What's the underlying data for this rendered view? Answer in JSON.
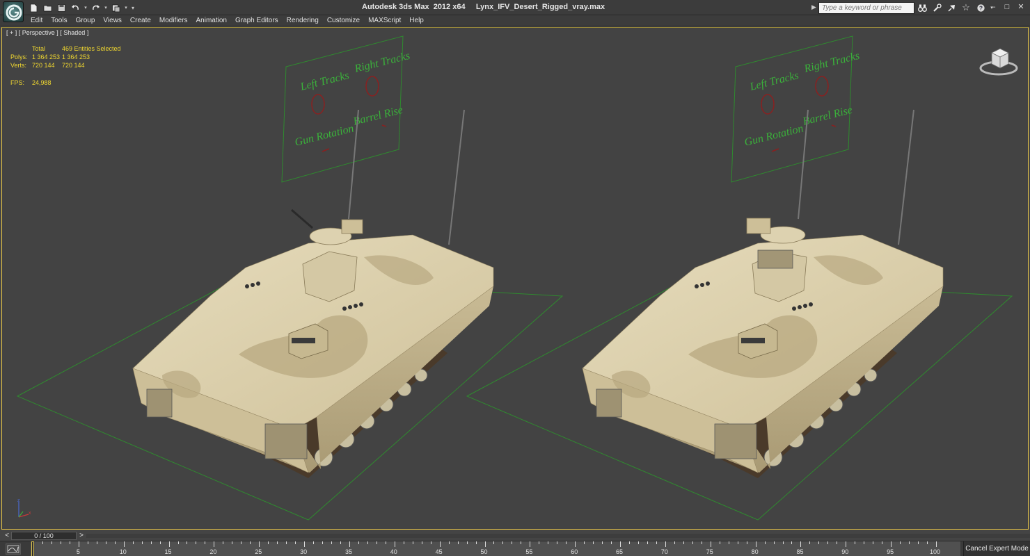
{
  "titlebar": {
    "app_name": "Autodesk 3ds Max  2012 x64",
    "file_name": "Lynx_IFV_Desert_Rigged_vray.max",
    "search_placeholder": "Type a keyword or phrase"
  },
  "menu": [
    {
      "label": "Edit"
    },
    {
      "label": "Tools"
    },
    {
      "label": "Group"
    },
    {
      "label": "Views"
    },
    {
      "label": "Create"
    },
    {
      "label": "Modifiers"
    },
    {
      "label": "Animation"
    },
    {
      "label": "Graph Editors"
    },
    {
      "label": "Rendering"
    },
    {
      "label": "Customize"
    },
    {
      "label": "MAXScript"
    },
    {
      "label": "Help"
    }
  ],
  "viewport": {
    "label": "[ + ] [ Perspective ] [ Shaded ]",
    "stats": {
      "header": {
        "label": "",
        "total": "Total",
        "selected": "469 Entities Selected"
      },
      "polys": {
        "label": "Polys:",
        "total": "1 364 253",
        "selected": "1 364 253"
      },
      "verts": {
        "label": "Verts:",
        "total": "720 144",
        "selected": "720 144"
      },
      "fps": {
        "label": "FPS:",
        "value": "24,988"
      }
    },
    "control_panel_labels": {
      "left_tracks": "Left Tracks",
      "right_tracks": "Right Tracks",
      "gun_rotation": "Gun Rotation",
      "barrel_rise": "Barrel Rise"
    },
    "colors": {
      "background": "#434343",
      "grid_green": "#2f8a2f",
      "vehicle_sand": "#d8cca8",
      "stats_yellow": "#f0d730"
    }
  },
  "timeline": {
    "frame_display": "0 / 100",
    "prev_label": "<",
    "next_label": ">",
    "ticks": [
      "5",
      "10",
      "15",
      "20",
      "25",
      "30",
      "35",
      "40",
      "45",
      "50",
      "55",
      "60",
      "65",
      "70",
      "75",
      "80",
      "85",
      "90",
      "95",
      "100"
    ],
    "expert_mode_button": "Cancel Expert Mode"
  }
}
